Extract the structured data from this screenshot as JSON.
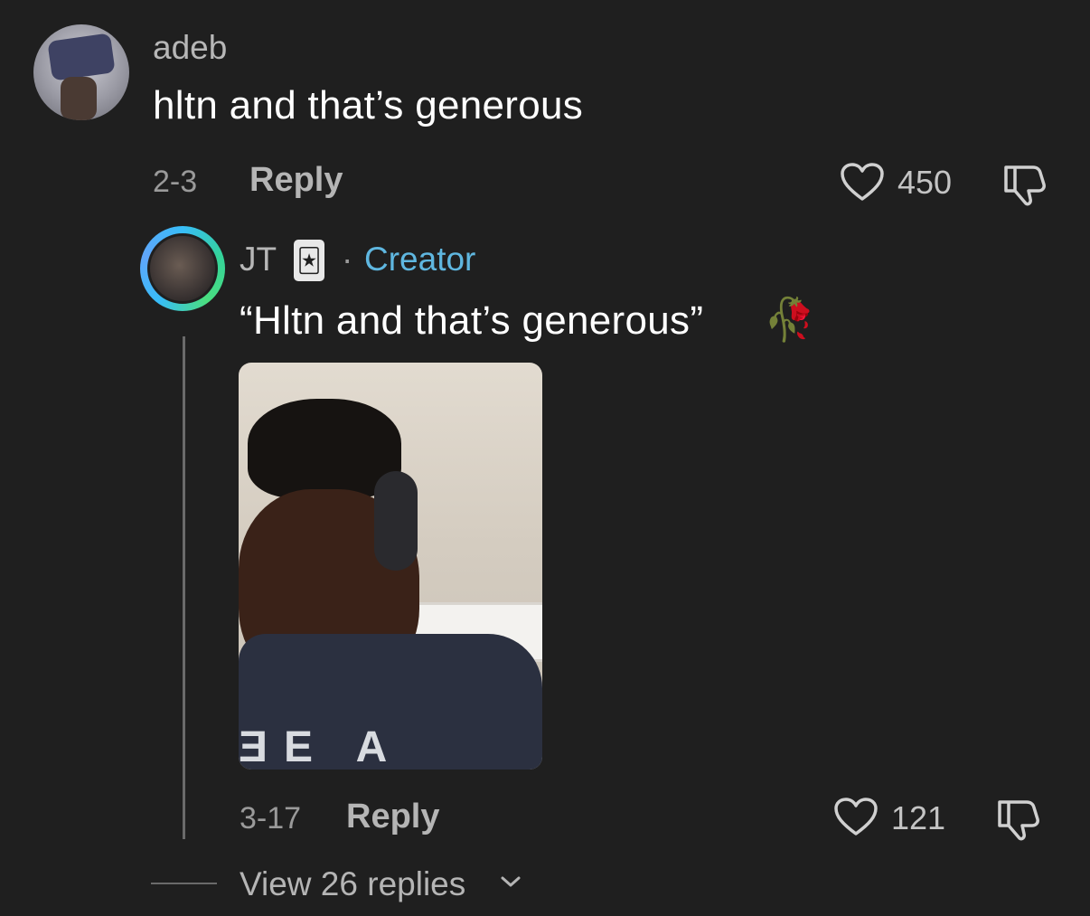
{
  "comment": {
    "username": "adeb",
    "text": "hltn and that’s generous",
    "date": "2-3",
    "reply_label": "Reply",
    "like_count": "450"
  },
  "reply": {
    "username": "JT",
    "badge_glyph": "🃏",
    "separator": "·",
    "creator_label": "Creator",
    "text": "“Hltn and that’s generous”",
    "emoji": "🥀",
    "image_text": "ƎE A",
    "date": "3-17",
    "reply_label": "Reply",
    "like_count": "121"
  },
  "view_replies_label": "View 26 replies",
  "colors": {
    "background": "#1f1f1f",
    "creator_accent": "#5fb7e0",
    "muted_text": "#9a9a9a"
  }
}
